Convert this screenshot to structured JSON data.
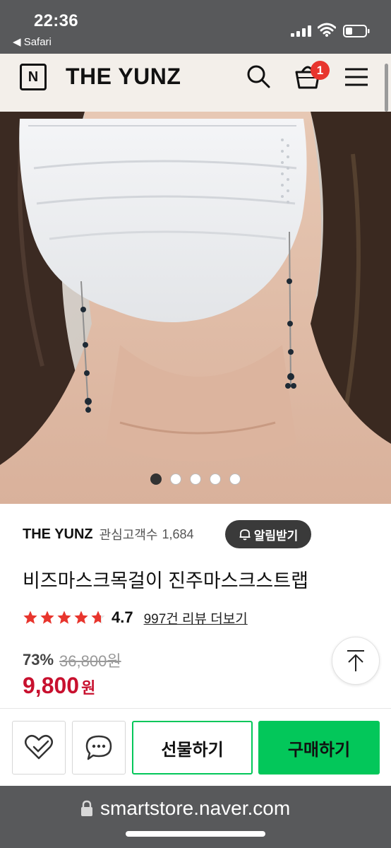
{
  "status_bar": {
    "time": "22:36",
    "back_app": "◀ Safari"
  },
  "header": {
    "logo_letter": "N",
    "store_name": "THE YUNZ",
    "cart_count": "1"
  },
  "carousel": {
    "total_slides": 5,
    "active_index": 0
  },
  "product": {
    "brand": "THE YUNZ",
    "followers_label": "관심고객수",
    "followers_count": "1,684",
    "alarm_label": "알림받기",
    "title": "비즈마스크목걸이 진주마스크스트랩",
    "rating": "4.7",
    "rating_stars_value": 4.7,
    "review_link": "997건 리뷰 더보기",
    "discount": "73%",
    "original_price": "36,800원",
    "price": "9,800",
    "price_unit": "원"
  },
  "bottom_bar": {
    "gift_label": "선물하기",
    "buy_label": "구매하기"
  },
  "address_bar": {
    "url": "smartstore.naver.com"
  },
  "colors": {
    "accent_green": "#03c75a",
    "price_red": "#c8102e",
    "star_red": "#e8352d",
    "header_bg": "#f3efea",
    "chrome_gray": "#58595b"
  }
}
